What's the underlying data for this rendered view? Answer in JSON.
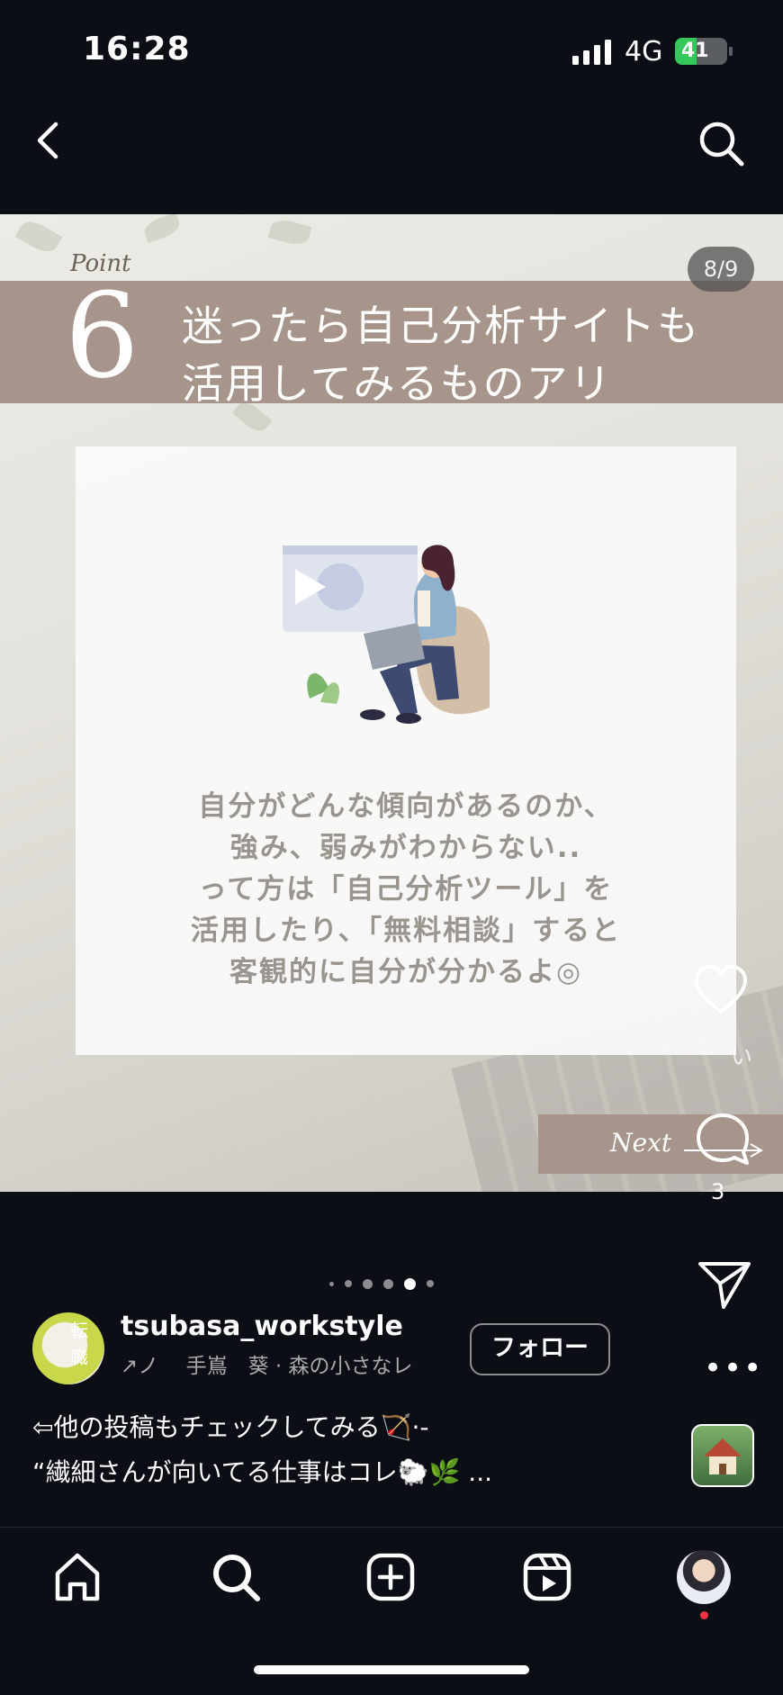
{
  "status_bar": {
    "time": "16:28",
    "network": "4G",
    "battery": "41"
  },
  "post": {
    "counter": "8/9",
    "point_label": "Point",
    "point_number": "6",
    "heading_line1": "迷ったら自己分析サイトも",
    "heading_line2": "活用してみるものアリ",
    "body_lines": [
      "自分がどんな傾向があるのか、",
      "強み、弱みがわからない..",
      "って方は「自己分析ツール」を",
      "活用したり、「無料相談」すると",
      "客観的に自分が分かるよ◎"
    ],
    "next_label": "Next",
    "ghost_text": "い"
  },
  "actions": {
    "comment_count": "3",
    "more_label": "•••"
  },
  "carousel": {
    "total_visible_dots": 6,
    "active_index": 4
  },
  "account": {
    "avatar_text1": "転",
    "avatar_text2": "職",
    "username": "tsubasa_workstyle",
    "subline": "↗ノ　 手嶌　葵 · 森の小さなレ",
    "follow_label": "フォロー"
  },
  "caption": {
    "line1": "⇦他の投稿もチェックしてみる🏹·-",
    "line2": "“繊細さんが向いてる仕事はコレ🐑🌿 ..."
  },
  "tab_bar": {
    "items": [
      "home-icon",
      "search-icon",
      "create-icon",
      "reels-icon",
      "profile-avatar"
    ]
  },
  "colors": {
    "band": "#a7958b",
    "background": "#0b0e14",
    "card_text": "#9a948e"
  }
}
